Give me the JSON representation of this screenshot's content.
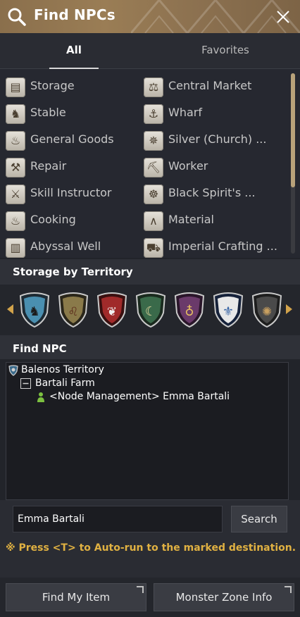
{
  "header": {
    "title": "Find NPCs"
  },
  "tabs": [
    {
      "label": "All"
    },
    {
      "label": "Favorites"
    }
  ],
  "categories": [
    {
      "label": "Storage",
      "icon": "storage-icon"
    },
    {
      "label": "Central Market",
      "icon": "scales-icon"
    },
    {
      "label": "Stable",
      "icon": "horse-icon"
    },
    {
      "label": "Wharf",
      "icon": "anchor-icon"
    },
    {
      "label": "General Goods",
      "icon": "bag-icon"
    },
    {
      "label": "Silver (Church) ...",
      "icon": "church-icon"
    },
    {
      "label": "Repair",
      "icon": "anvil-icon"
    },
    {
      "label": "Worker",
      "icon": "pickaxe-icon"
    },
    {
      "label": "Skill Instructor",
      "icon": "crossed-swords-icon"
    },
    {
      "label": "Black Spirit's ...",
      "icon": "spirit-icon"
    },
    {
      "label": "Cooking",
      "icon": "cooking-icon"
    },
    {
      "label": "Material",
      "icon": "material-icon"
    },
    {
      "label": "Abyssal Well",
      "icon": "well-icon"
    },
    {
      "label": "Imperial Crafting ...",
      "icon": "crafting-icon"
    }
  ],
  "territory": {
    "title": "Storage by Territory",
    "crests": [
      {
        "name": "balenos-crest",
        "color": "#4a8fb0"
      },
      {
        "name": "serendia-crest",
        "color": "#8a7a4a"
      },
      {
        "name": "calpheon-crest",
        "color": "#a02a2a"
      },
      {
        "name": "mediah-crest",
        "color": "#3a6a4a"
      },
      {
        "name": "valencia-crest",
        "color": "#6a3a6a"
      },
      {
        "name": "kamasylvia-crest",
        "color": "#3a66a6"
      },
      {
        "name": "drieghan-crest",
        "color": "#4a4a4a"
      }
    ]
  },
  "find": {
    "title": "Find NPC",
    "tree": {
      "territory": "Balenos Territory",
      "node": "Bartali Farm",
      "npc": "<Node Management> Emma Bartali"
    }
  },
  "search": {
    "value": "Emma Bartali",
    "button": "Search"
  },
  "hint": "※ Press <T> to Auto-run to the marked destination.",
  "buttons": {
    "find_item": "Find My Item",
    "monster_zone": "Monster Zone Info"
  },
  "colors": {
    "accent": "#e0b142",
    "titlebar": "#8f7451"
  }
}
